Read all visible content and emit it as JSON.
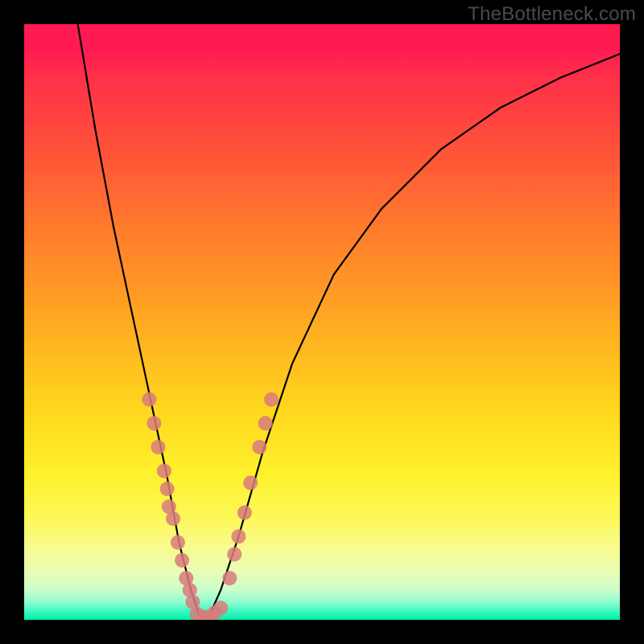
{
  "watermark": "TheBottleneck.com",
  "chart_data": {
    "type": "line",
    "title": "",
    "xlabel": "",
    "ylabel": "",
    "xlim": [
      0,
      100
    ],
    "ylim": [
      0,
      100
    ],
    "grid": false,
    "background": {
      "gradient_orientation": "vertical",
      "stops": [
        {
          "pos": 0,
          "color": "#ff1a52"
        },
        {
          "pos": 50,
          "color": "#ffb91f"
        },
        {
          "pos": 85,
          "color": "#fdf85a"
        },
        {
          "pos": 100,
          "color": "#00eea6"
        }
      ]
    },
    "series": [
      {
        "name": "bottleneck-curve",
        "color": "#000000",
        "x": [
          9,
          12,
          15,
          18,
          21,
          24,
          26,
          28,
          29.5,
          31,
          33,
          36,
          40,
          45,
          52,
          60,
          70,
          80,
          90,
          100
        ],
        "y": [
          100,
          82,
          66,
          52,
          38,
          24,
          13,
          5,
          0.5,
          0.5,
          5,
          14,
          28,
          43,
          58,
          69,
          79,
          86,
          91,
          95
        ]
      }
    ],
    "markers": [
      {
        "name": "scatter-left-branch",
        "color": "#d97b7b",
        "points": [
          {
            "x": 21.0,
            "y": 37
          },
          {
            "x": 21.8,
            "y": 33
          },
          {
            "x": 22.5,
            "y": 29
          },
          {
            "x": 23.5,
            "y": 25
          },
          {
            "x": 24.0,
            "y": 22
          },
          {
            "x": 24.3,
            "y": 19
          },
          {
            "x": 25.0,
            "y": 17
          },
          {
            "x": 25.8,
            "y": 13
          },
          {
            "x": 26.5,
            "y": 10
          },
          {
            "x": 27.2,
            "y": 7
          },
          {
            "x": 27.8,
            "y": 5
          },
          {
            "x": 28.3,
            "y": 3
          }
        ]
      },
      {
        "name": "scatter-valley",
        "color": "#d97b7b",
        "points": [
          {
            "x": 29.0,
            "y": 1
          },
          {
            "x": 30.0,
            "y": 0.5
          },
          {
            "x": 31.0,
            "y": 0.5
          },
          {
            "x": 32.0,
            "y": 1.2
          },
          {
            "x": 33.0,
            "y": 2
          }
        ]
      },
      {
        "name": "scatter-right-branch",
        "color": "#d97b7b",
        "points": [
          {
            "x": 34.5,
            "y": 7
          },
          {
            "x": 35.3,
            "y": 11
          },
          {
            "x": 36.0,
            "y": 14
          },
          {
            "x": 37.0,
            "y": 18
          },
          {
            "x": 38.0,
            "y": 23
          },
          {
            "x": 39.5,
            "y": 29
          },
          {
            "x": 40.5,
            "y": 33
          },
          {
            "x": 41.5,
            "y": 37
          }
        ]
      }
    ]
  }
}
